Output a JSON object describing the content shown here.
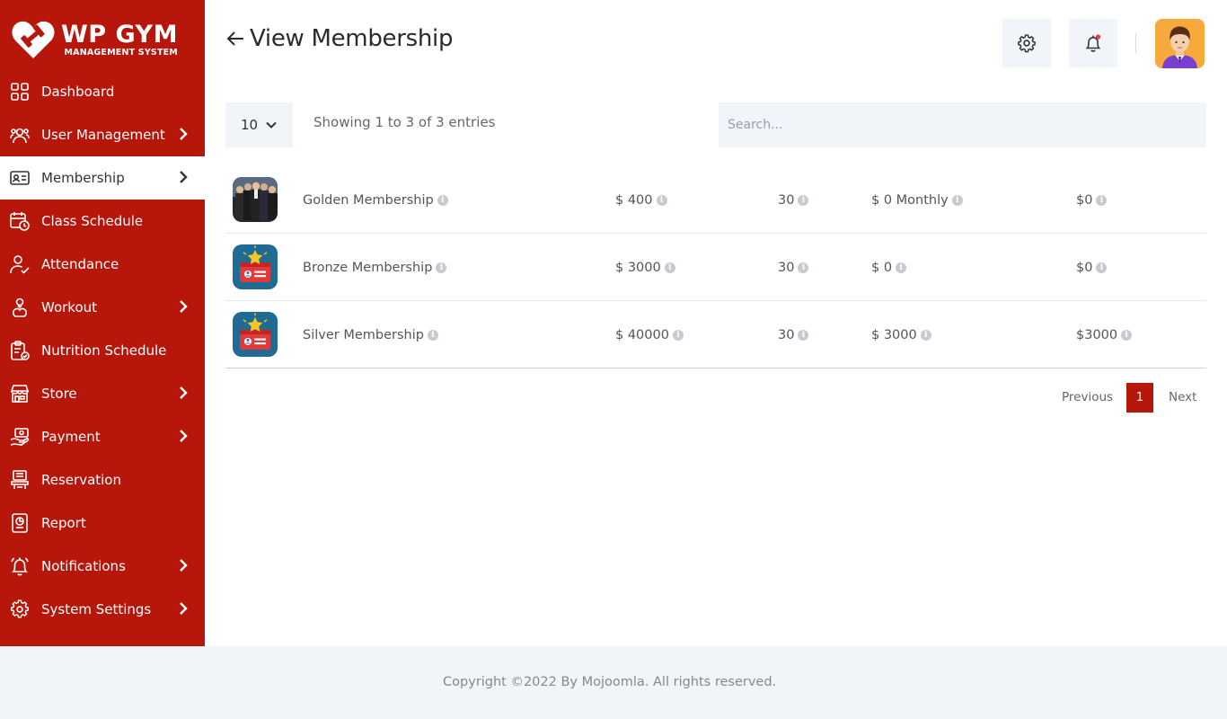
{
  "brand": {
    "title": "WP GYM",
    "subtitle": "MANAGEMENT SYSTEM",
    "color": "#b7160b"
  },
  "sidebar": {
    "items": [
      {
        "label": "Dashboard",
        "icon": "dashboard-grid-icon",
        "has_submenu": false,
        "active": false
      },
      {
        "label": "User Management",
        "icon": "users-gear-icon",
        "has_submenu": true,
        "active": false
      },
      {
        "label": "Membership",
        "icon": "membership-card-icon",
        "has_submenu": true,
        "active": true
      },
      {
        "label": "Class Schedule",
        "icon": "calendar-clock-icon",
        "has_submenu": false,
        "active": false
      },
      {
        "label": "Attendance",
        "icon": "user-check-icon",
        "has_submenu": false,
        "active": false
      },
      {
        "label": "Workout",
        "icon": "workout-icon",
        "has_submenu": true,
        "active": false
      },
      {
        "label": "Nutrition Schedule",
        "icon": "nutrition-clipboard-icon",
        "has_submenu": false,
        "active": false
      },
      {
        "label": "Store",
        "icon": "store-icon",
        "has_submenu": true,
        "active": false
      },
      {
        "label": "Payment",
        "icon": "payment-hand-icon",
        "has_submenu": true,
        "active": false
      },
      {
        "label": "Reservation",
        "icon": "reservation-icon",
        "has_submenu": false,
        "active": false
      },
      {
        "label": "Report",
        "icon": "report-icon",
        "has_submenu": false,
        "active": false
      },
      {
        "label": "Notifications",
        "icon": "bell-icon",
        "has_submenu": true,
        "active": false
      },
      {
        "label": "System Settings",
        "icon": "gear-icon",
        "has_submenu": true,
        "active": false
      }
    ]
  },
  "header": {
    "title": "View Membership",
    "back_icon": "arrow-left-icon",
    "settings_icon": "gear-icon",
    "notification_icon": "bell-icon"
  },
  "controls": {
    "page_size": "10",
    "info": "Showing 1 to 3 of 3 entries",
    "search_placeholder": "Search..."
  },
  "table": {
    "rows": [
      {
        "image": "team-photo",
        "name": "Golden Membership",
        "amount": "$ 400",
        "period": "30",
        "installment": "$ 0 Monthly",
        "signup_fee": "$0"
      },
      {
        "image": "membership-badge",
        "name": "Bronze Membership",
        "amount": "$ 3000",
        "period": "30",
        "installment": "$ 0",
        "signup_fee": "$0"
      },
      {
        "image": "membership-badge",
        "name": "Silver Membership",
        "amount": "$ 40000",
        "period": "30",
        "installment": "$ 3000",
        "signup_fee": "$3000"
      }
    ]
  },
  "pagination": {
    "previous": "Previous",
    "current": "1",
    "next": "Next"
  },
  "footer": {
    "text": "Copyright ©2022 By Mojoomla. All rights reserved."
  }
}
